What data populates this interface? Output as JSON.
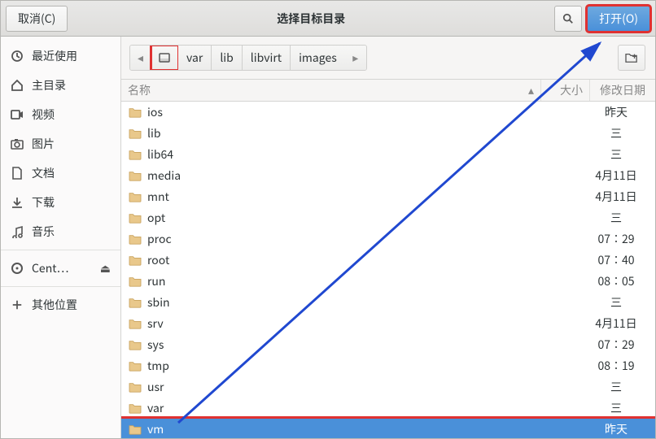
{
  "titlebar": {
    "cancel": "取消(C)",
    "title": "选择目标目录",
    "open": "打开(O)"
  },
  "sidebar": {
    "items": [
      {
        "icon": "clock-icon",
        "label": "最近使用"
      },
      {
        "icon": "home-icon",
        "label": "主目录"
      },
      {
        "icon": "video-icon",
        "label": "视频"
      },
      {
        "icon": "camera-icon",
        "label": "图片"
      },
      {
        "icon": "document-icon",
        "label": "文档"
      },
      {
        "icon": "download-icon",
        "label": "下载"
      },
      {
        "icon": "music-icon",
        "label": "音乐"
      }
    ],
    "device": {
      "icon": "disc-icon",
      "label": "Cent…",
      "eject": "⏏"
    },
    "other": {
      "icon": "plus-icon",
      "label": "其他位置"
    }
  },
  "pathbar": {
    "segments": [
      "var",
      "lib",
      "libvirt",
      "images"
    ]
  },
  "columns": {
    "name": "名称",
    "size": "大小",
    "date": "修改日期"
  },
  "files": [
    {
      "name": "ios",
      "date": "昨天"
    },
    {
      "name": "lib",
      "date": "三"
    },
    {
      "name": "lib64",
      "date": "三"
    },
    {
      "name": "media",
      "date": "4月11日"
    },
    {
      "name": "mnt",
      "date": "4月11日"
    },
    {
      "name": "opt",
      "date": "三"
    },
    {
      "name": "proc",
      "date": "07∶29"
    },
    {
      "name": "root",
      "date": "07∶40"
    },
    {
      "name": "run",
      "date": "08∶05"
    },
    {
      "name": "sbin",
      "date": "三"
    },
    {
      "name": "srv",
      "date": "4月11日"
    },
    {
      "name": "sys",
      "date": "07∶29"
    },
    {
      "name": "tmp",
      "date": "08∶19"
    },
    {
      "name": "usr",
      "date": "三"
    },
    {
      "name": "var",
      "date": "三"
    },
    {
      "name": "vm",
      "date": "昨天",
      "selected": true,
      "highlight": true
    }
  ]
}
